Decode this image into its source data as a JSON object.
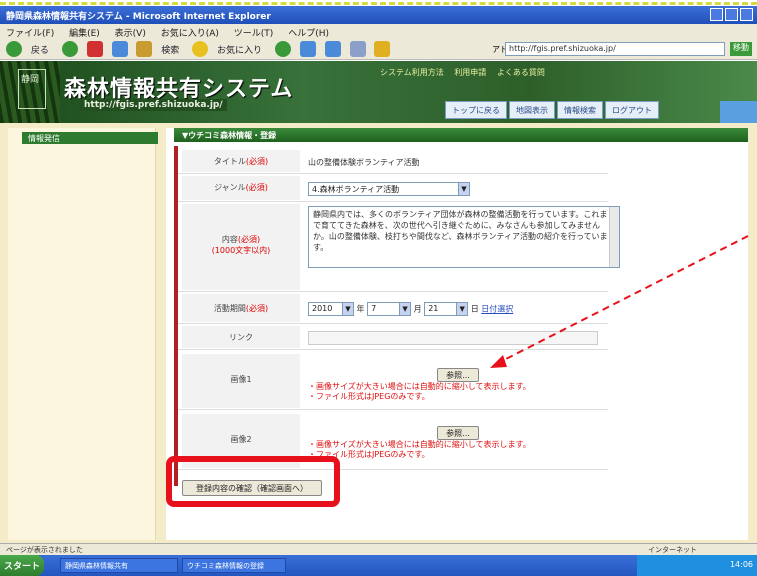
{
  "browser": {
    "window_title": "静岡県森林情報共有システム - Microsoft Internet Explorer",
    "menu": [
      "ファイル(F)",
      "編集(E)",
      "表示(V)",
      "お気に入り(A)",
      "ツール(T)",
      "ヘルプ(H)"
    ],
    "toolbar": {
      "back_label": "戻る",
      "search_label": "検索",
      "favorites_label": "お気に入り"
    },
    "address_label": "アドレス(D)",
    "address_value": "http://fgis.pref.shizuoka.jp/",
    "go_label": "移動"
  },
  "site": {
    "logo_text": "静岡",
    "title": "森林情報共有システム",
    "url": "http://fgis.pref.shizuoka.jp/",
    "top_links": [
      "システム利用方法",
      "利用申請",
      "よくある質問"
    ],
    "tabs": [
      "トップに戻る",
      "地図表示",
      "情報検索",
      "ログアウト"
    ]
  },
  "sidebar": {
    "button": "情報発信"
  },
  "content": {
    "header": "▼ウチコミ森林情報・登録",
    "fields": {
      "title": {
        "label": "タイトル",
        "req": "(必須)",
        "value": "山の整備体験ボランティア活動"
      },
      "genre": {
        "label": "ジャンル",
        "req": "(必須)",
        "value": "4.森林ボランティア活動"
      },
      "detail": {
        "label": "内容",
        "req": "(必須)",
        "note": "(1000文字以内)",
        "value": "静岡県内では、多くのボランティア団体が森林の整備活動を行っています。これまで育ててきた森林を、次の世代へ引き継ぐために、みなさんも参加してみませんか。山の整備体験、枝打ちや間伐など、森林ボランティア活動の紹介を行っています。"
      },
      "date": {
        "label": "活動期間",
        "req": "(必須)",
        "year": "2010",
        "year_unit": "年",
        "month": "7",
        "month_unit": "月",
        "day": "21",
        "day_unit": "日",
        "link": "日付選択"
      },
      "link": {
        "label": "リンク",
        "value": ""
      },
      "image1": {
        "label": "画像1",
        "button": "参照...",
        "warn1": "・画像サイズが大きい場合には自動的に縮小して表示します。",
        "warn2": "・ファイル形式はJPEGのみです。"
      },
      "image2": {
        "label": "画像2",
        "button": "参照...",
        "warn1": "・画像サイズが大きい場合には自動的に縮小して表示します。",
        "warn2": "・ファイル形式はJPEGのみです。"
      }
    },
    "confirm_button": "登録内容の確認（確認画面へ）"
  },
  "statusbar": {
    "left": "ページが表示されました",
    "zone": "インターネット"
  },
  "taskbar": {
    "start": "スタート",
    "tasks": [
      "静岡県森林情報共有",
      "ウチコミ森林情報の登録"
    ],
    "clock": "14:06"
  },
  "colors": {
    "annotation_red": "#e8101a",
    "header_green": "#2e7a2e",
    "warning_red": "#e01010"
  }
}
